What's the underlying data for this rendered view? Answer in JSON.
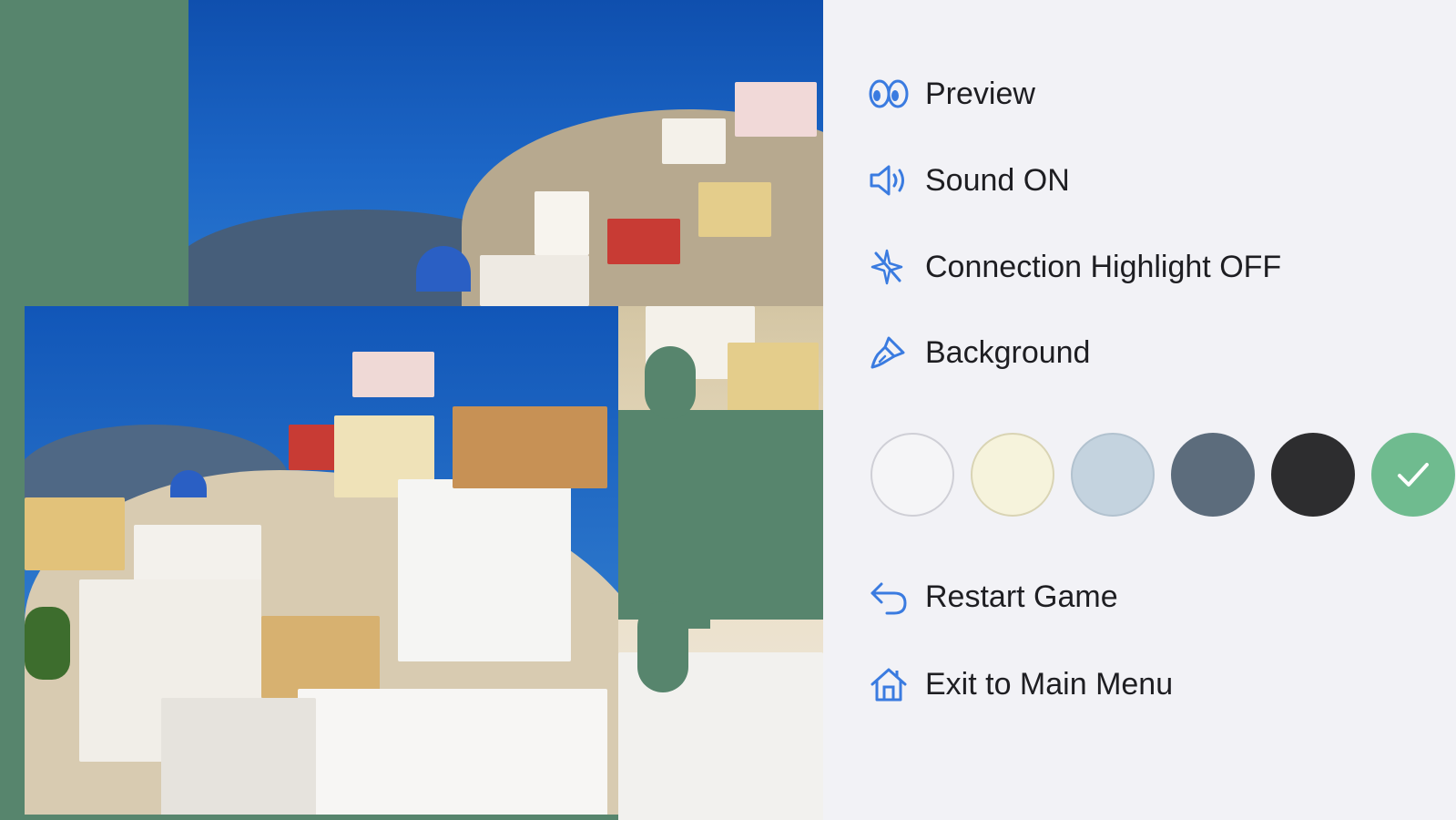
{
  "menu": {
    "items": [
      {
        "key": "preview",
        "label": "Preview",
        "icon": "eyes-icon"
      },
      {
        "key": "sound",
        "label": "Sound ON",
        "icon": "speaker-icon"
      },
      {
        "key": "highlight",
        "label": "Connection Highlight OFF",
        "icon": "sparkle-off-icon"
      },
      {
        "key": "background",
        "label": "Background",
        "icon": "paint-brush-icon"
      }
    ],
    "background_colors": [
      {
        "name": "white",
        "hex": "#f5f5f7",
        "border": "#cfcfd6",
        "selected": false
      },
      {
        "name": "cream",
        "hex": "#f6f3dc",
        "border": "#d9d4b4",
        "selected": false
      },
      {
        "name": "light-blue",
        "hex": "#c4d3df",
        "border": "#b2c2cf",
        "selected": false
      },
      {
        "name": "slate",
        "hex": "#5c6c7c",
        "border": "#5c6c7c",
        "selected": false
      },
      {
        "name": "charcoal",
        "hex": "#2d2d2f",
        "border": "#2d2d2f",
        "selected": false
      },
      {
        "name": "green",
        "hex": "#6fbb8f",
        "border": "#6fbb8f",
        "selected": true
      }
    ],
    "actions": [
      {
        "key": "restart",
        "label": "Restart Game",
        "icon": "restart-arrow-icon"
      },
      {
        "key": "exit",
        "label": "Exit to Main Menu",
        "icon": "house-icon"
      }
    ]
  },
  "colors": {
    "accent": "#3a7be0",
    "board_bg": "#57856d",
    "panel_bg": "#f2f2f6"
  }
}
